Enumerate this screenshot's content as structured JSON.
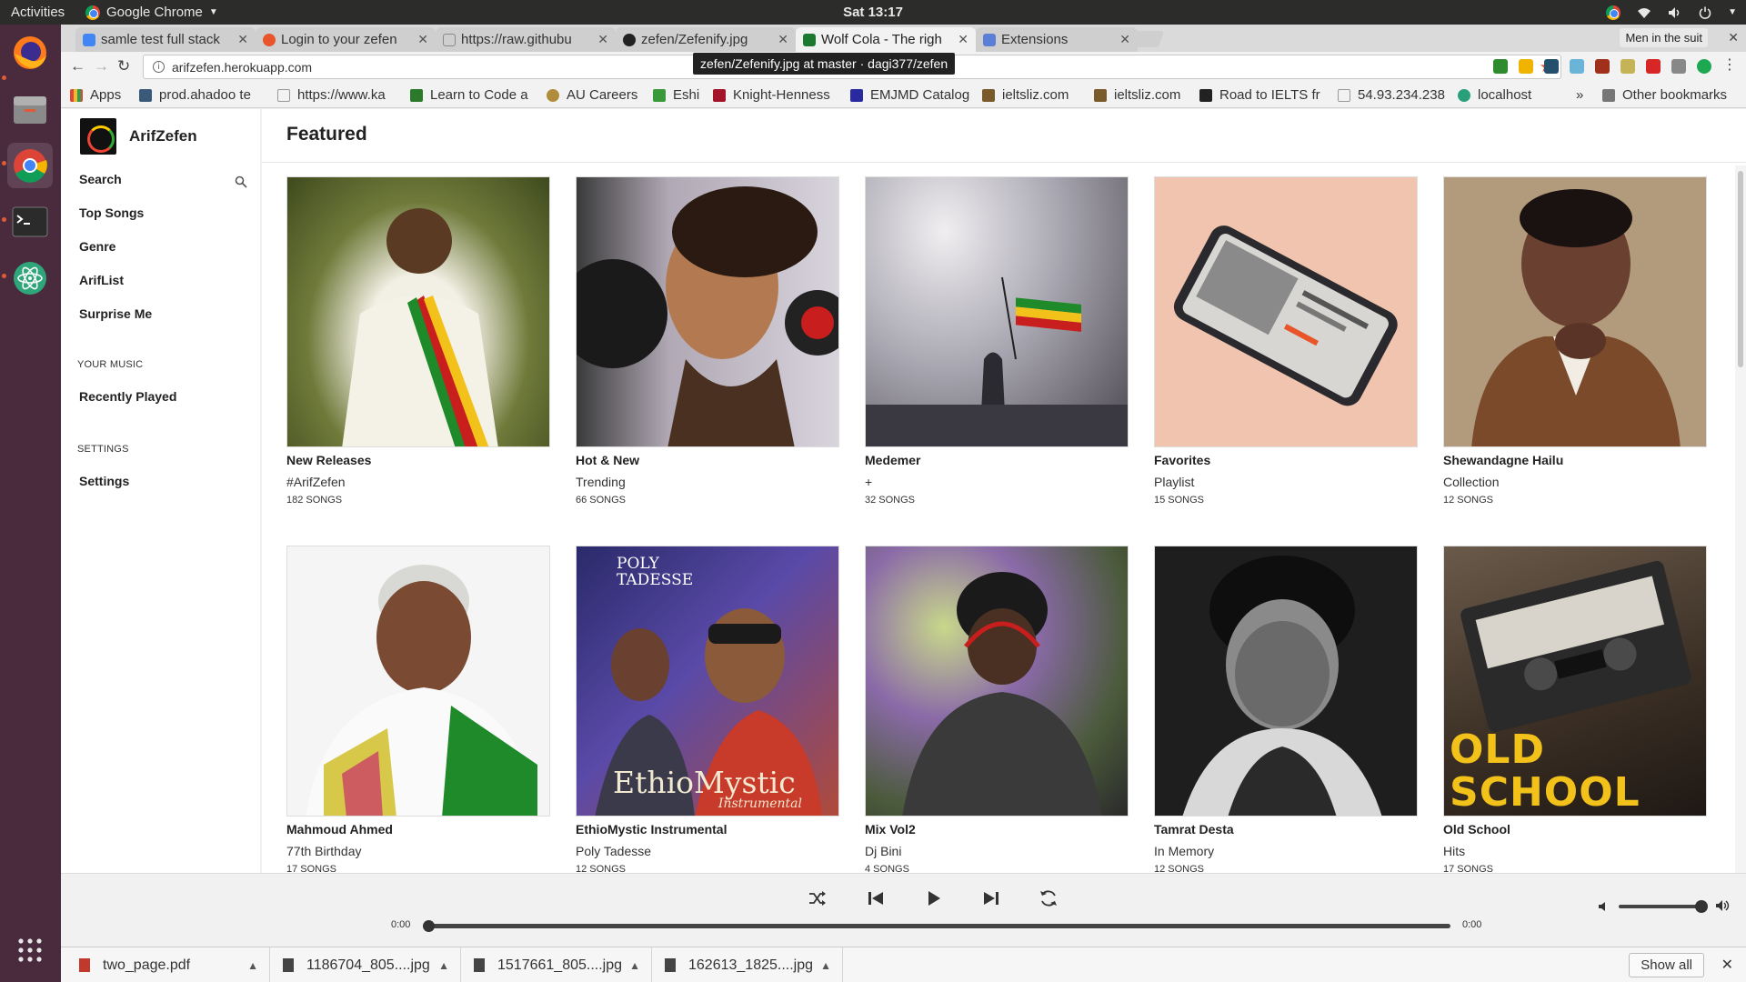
{
  "os_bar": {
    "activities": "Activities",
    "app_name": "Google Chrome",
    "clock": "Sat 13:17"
  },
  "browser": {
    "tabs": [
      {
        "title": "samle test full stack",
        "color": "#4285f4"
      },
      {
        "title": "Login to your zefen",
        "color": "#e8552a"
      },
      {
        "title": "https://raw.githubu",
        "color": "#888888"
      },
      {
        "title": "zefen/Zefenify.jpg",
        "color": "#222222"
      },
      {
        "title": "Wolf Cola - The righ",
        "color": "#1b7a2e"
      },
      {
        "title": "Extensions",
        "color": "#5a7fd6"
      }
    ],
    "profile_name": "Men in the suit",
    "url": "arifzefen.herokuapp.com",
    "tooltip": "zefen/Zefenify.jpg at master · dagi377/zefen",
    "bookmarks": [
      {
        "label": "Apps",
        "color": "#777777"
      },
      {
        "label": "prod.ahadoo te",
        "color": "#3a5a7a"
      },
      {
        "label": "https://www.ka",
        "color": "#999999"
      },
      {
        "label": "Learn to Code a",
        "color": "#2b7a2b"
      },
      {
        "label": "AU Careers",
        "color": "#b08d3a"
      },
      {
        "label": "Eshi",
        "color": "#3a9a3a"
      },
      {
        "label": "Knight-Henness",
        "color": "#a3142a"
      },
      {
        "label": "EMJMD Catalog",
        "color": "#2a2aa0"
      },
      {
        "label": "ieltsliz.com",
        "color": "#7a5a2a"
      },
      {
        "label": "ieltsliz.com",
        "color": "#7a5a2a"
      },
      {
        "label": "Road to IELTS fr",
        "color": "#222222"
      },
      {
        "label": "54.93.234.238",
        "color": "#999999"
      },
      {
        "label": "localhost",
        "color": "#2aa07a"
      }
    ],
    "bookmarks_overflow": "»",
    "other_bookmarks": "Other bookmarks"
  },
  "app": {
    "brand": "ArifZefen",
    "nav": {
      "search": "Search",
      "top_songs": "Top Songs",
      "genre": "Genre",
      "arif_list": "ArifList",
      "surprise_me": "Surprise Me",
      "your_music_header": "YOUR MUSIC",
      "recently_played": "Recently Played",
      "settings_header": "SETTINGS",
      "settings": "Settings"
    },
    "page_title": "Featured",
    "cards": [
      {
        "title": "New Releases",
        "subtitle": "#ArifZefen",
        "count": "182 SONGS",
        "bg": "#5a6a2a"
      },
      {
        "title": "Hot & New",
        "subtitle": "Trending",
        "count": "66 SONGS",
        "bg": "#8a7a7a"
      },
      {
        "title": "Medemer",
        "subtitle": "+",
        "count": "32 SONGS",
        "bg": "#8a8a92"
      },
      {
        "title": "Favorites",
        "subtitle": "Playlist",
        "count": "15 SONGS",
        "bg": "#f0c4ae"
      },
      {
        "title": "Shewandagne Hailu",
        "subtitle": "Collection",
        "count": "12 SONGS",
        "bg": "#a89274"
      },
      {
        "title": "Mahmoud Ahmed",
        "subtitle": "77th Birthday",
        "count": "17 SONGS",
        "bg": "#f3f3f3"
      },
      {
        "title": "EthioMystic Instrumental",
        "subtitle": "Poly Tadesse",
        "count": "12 SONGS",
        "bg": "#3a3a8a"
      },
      {
        "title": "Mix Vol2",
        "subtitle": "Dj Bini",
        "count": "4 SONGS",
        "bg": "#7a8a6a"
      },
      {
        "title": "Tamrat Desta",
        "subtitle": "In Memory",
        "count": "12 SONGS",
        "bg": "#2a2a2a"
      },
      {
        "title": "Old School",
        "subtitle": "Hits",
        "count": "17 SONGS",
        "bg": "#4a3a2a"
      }
    ],
    "cover_text": {
      "poly_tadesse": "POLY TADESSE",
      "ethiomystic": "EthioMystic",
      "instrumental": "Instrumental",
      "old": "OLD",
      "school": "SCHOOL"
    }
  },
  "player": {
    "elapsed": "0:00",
    "duration": "0:00",
    "progress": 0,
    "volume": 1.0
  },
  "downloads": {
    "items": [
      {
        "name": "two_page.pdf",
        "color": "#c0392b"
      },
      {
        "name": "1186704_805....jpg",
        "color": "#444444"
      },
      {
        "name": "1517661_805....jpg",
        "color": "#444444"
      },
      {
        "name": "162613_1825....jpg",
        "color": "#444444"
      }
    ],
    "show_all": "Show all"
  }
}
